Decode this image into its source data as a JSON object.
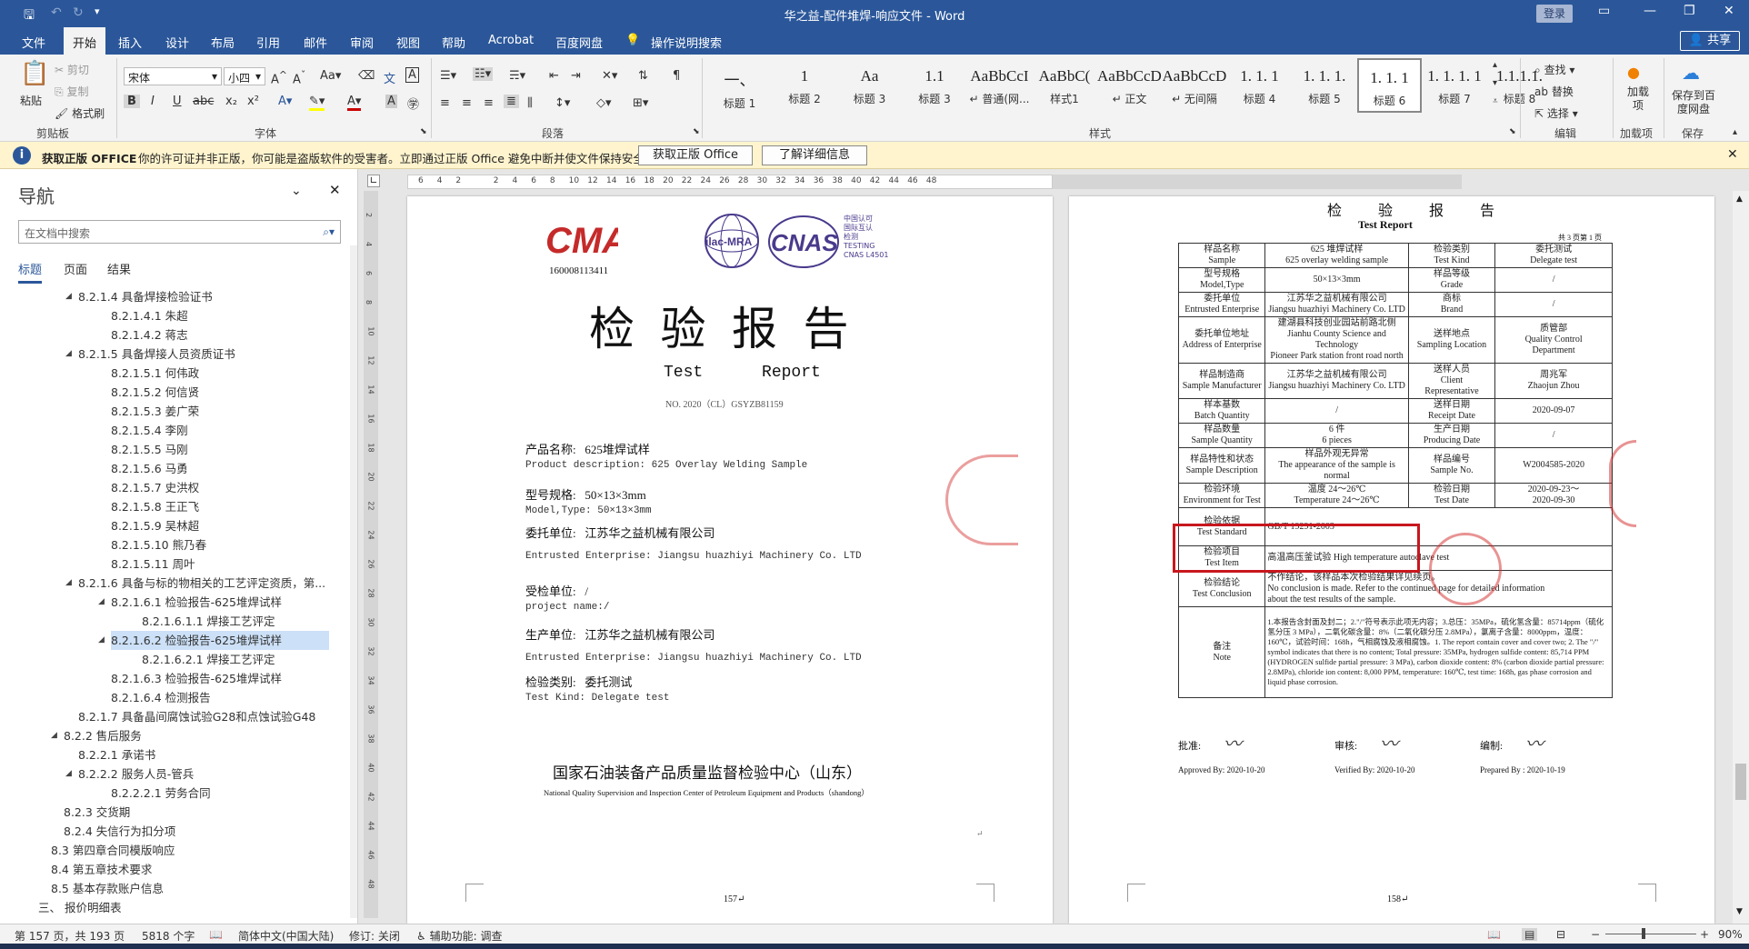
{
  "window": {
    "title": "华之益-配件堆焊-响应文件 - Word",
    "login": "登录"
  },
  "menu": {
    "tabs": [
      "文件",
      "开始",
      "插入",
      "设计",
      "布局",
      "引用",
      "邮件",
      "审阅",
      "视图",
      "帮助",
      "Acrobat",
      "百度网盘"
    ],
    "tellme": "操作说明搜索",
    "share": "共享"
  },
  "ribbon": {
    "clipboard": {
      "paste": "粘贴",
      "cut": "剪切",
      "copy": "复制",
      "painter": "格式刷",
      "label": "剪贴板"
    },
    "font": {
      "name": "宋体",
      "size": "小四",
      "label": "字体"
    },
    "paragraph": {
      "label": "段落"
    },
    "styles": {
      "label": "样式",
      "items": [
        {
          "preview": "一、",
          "name": "标题 1"
        },
        {
          "preview": "1",
          "name": "标题 2"
        },
        {
          "preview": "Aa",
          "name": "标题 3"
        },
        {
          "preview": "1.1",
          "name": "标题 3"
        },
        {
          "preview": "AaBbCcI",
          "name": "↵ 普通(网..."
        },
        {
          "preview": "AaBbC(",
          "name": "样式1"
        },
        {
          "preview": "AaBbCcDdI",
          "name": "↵ 正文"
        },
        {
          "preview": "AaBbCcDdI",
          "name": "↵ 无间隔"
        },
        {
          "preview": "1. 1. 1",
          "name": "标题 4"
        },
        {
          "preview": "1. 1. 1.",
          "name": "标题 5"
        },
        {
          "preview": "1. 1. 1",
          "name": "标题 6"
        },
        {
          "preview": "1. 1. 1. 1",
          "name": "标题 7"
        },
        {
          "preview": "1.1.1.1.",
          "name": "标题 8"
        }
      ]
    },
    "editing": {
      "find": "查找",
      "replace": "替换",
      "select": "选择",
      "label": "编辑"
    },
    "addins": {
      "btn": "加载项",
      "label": "加载项"
    },
    "save": {
      "btn": "保存到百度网盘",
      "label": "保存"
    }
  },
  "warning": {
    "title": "获取正版 OFFICE",
    "text": "你的许可证并非正版，你可能是盗版软件的受害者。立即通过正版 Office 避免中断并使文件保持安全。",
    "btn1": "获取正版 Office",
    "btn2": "了解详细信息"
  },
  "nav": {
    "title": "导航",
    "search_placeholder": "在文档中搜索",
    "tabs": [
      "标题",
      "页面",
      "结果"
    ],
    "items": [
      {
        "text": "8.2.1.4 具备焊接检验证书",
        "lvl": 3,
        "tri": "open"
      },
      {
        "text": "8.2.1.4.1 朱超",
        "lvl": 4,
        "tri": ""
      },
      {
        "text": "8.2.1.4.2 蒋志",
        "lvl": 4,
        "tri": ""
      },
      {
        "text": "8.2.1.5 具备焊接人员资质证书",
        "lvl": 3,
        "tri": "open"
      },
      {
        "text": "8.2.1.5.1 何伟政",
        "lvl": 4,
        "tri": ""
      },
      {
        "text": "8.2.1.5.2 何信贤",
        "lvl": 4,
        "tri": ""
      },
      {
        "text": "8.2.1.5.3 姜广荣",
        "lvl": 4,
        "tri": ""
      },
      {
        "text": "8.2.1.5.4 李刚",
        "lvl": 4,
        "tri": ""
      },
      {
        "text": "8.2.1.5.5 马刚",
        "lvl": 4,
        "tri": ""
      },
      {
        "text": "8.2.1.5.6 马勇",
        "lvl": 4,
        "tri": ""
      },
      {
        "text": "8.2.1.5.7 史洪权",
        "lvl": 4,
        "tri": ""
      },
      {
        "text": "8.2.1.5.8 王正飞",
        "lvl": 4,
        "tri": ""
      },
      {
        "text": "8.2.1.5.9 吴林超",
        "lvl": 4,
        "tri": ""
      },
      {
        "text": "8.2.1.5.10 熊乃春",
        "lvl": 4,
        "tri": ""
      },
      {
        "text": "8.2.1.5.11 周叶",
        "lvl": 4,
        "tri": ""
      },
      {
        "text": "8.2.1.6 具备与标的物相关的工艺评定资质，第...",
        "lvl": 3,
        "tri": "open"
      },
      {
        "text": "8.2.1.6.1 检验报告-625堆焊试样",
        "lvl": 4,
        "tri": "open"
      },
      {
        "text": "8.2.1.6.1.1 焊接工艺评定",
        "lvl": 5,
        "tri": ""
      },
      {
        "text": "8.2.1.6.2 检验报告-625堆焊试样",
        "lvl": 4,
        "tri": "open",
        "sel": true
      },
      {
        "text": "8.2.1.6.2.1 焊接工艺评定",
        "lvl": 5,
        "tri": ""
      },
      {
        "text": "8.2.1.6.3 检验报告-625堆焊试样",
        "lvl": 4,
        "tri": ""
      },
      {
        "text": "8.2.1.6.4 检测报告",
        "lvl": 4,
        "tri": ""
      },
      {
        "text": "8.2.1.7 具备晶间腐蚀试验G28和点蚀试验G48",
        "lvl": 3,
        "tri": ""
      },
      {
        "text": "8.2.2 售后服务",
        "lvl": 2,
        "tri": "open"
      },
      {
        "text": "8.2.2.1 承诺书",
        "lvl": 3,
        "tri": ""
      },
      {
        "text": "8.2.2.2 服务人员-管兵",
        "lvl": 3,
        "tri": "open"
      },
      {
        "text": "8.2.2.2.1 劳务合同",
        "lvl": 4,
        "tri": ""
      },
      {
        "text": "8.2.3 交货期",
        "lvl": 2,
        "tri": ""
      },
      {
        "text": "8.2.4 失信行为扣分项",
        "lvl": 2,
        "tri": ""
      },
      {
        "text": "8.3 第四章合同模版响应",
        "lvl": 1,
        "tri": ""
      },
      {
        "text": "8.4 第五章技术要求",
        "lvl": 1,
        "tri": ""
      },
      {
        "text": "8.5 基本存款账户信息",
        "lvl": 1,
        "tri": ""
      },
      {
        "text": "三、 报价明细表",
        "lvl": 0,
        "tri": ""
      }
    ]
  },
  "ruler": {
    "marks": [
      "6",
      "4",
      "2",
      "",
      "2",
      "4",
      "6",
      "8",
      "10",
      "12",
      "14",
      "16",
      "18",
      "20",
      "22",
      "24",
      "26",
      "28",
      "30",
      "32",
      "34",
      "36",
      "38",
      "40",
      "42",
      "44",
      "46",
      "48"
    ],
    "vmarks": [
      "2",
      "4",
      "6",
      "8",
      "10",
      "12",
      "14",
      "16",
      "18",
      "20",
      "22",
      "24",
      "26",
      "28",
      "30",
      "32",
      "34",
      "36",
      "38",
      "40",
      "42",
      "44",
      "46",
      "48"
    ]
  },
  "page1": {
    "cma_no": "160008113411",
    "cnas_text": [
      "中国认可",
      "国际互认",
      "检测",
      "TESTING",
      "CNAS L4501"
    ],
    "title": "检 验 报 告",
    "subtitle": "Test      Report",
    "no": "NO. 2020（CL）GSYZB81159",
    "fields": [
      {
        "cn": "产品名称:   625堆焊试样",
        "en": "Product description: 625 Overlay Welding Sample"
      },
      {
        "cn": "型号规格:   50×13×3mm",
        "en": "Model,Type: 50×13×3mm"
      },
      {
        "cn": "委托单位:   江苏华之益机械有限公司",
        "en": "Entrusted Enterprise: Jiangsu huazhiyi Machinery Co. LTD"
      },
      {
        "cn": "受检单位:   /",
        "en": "project name:/"
      },
      {
        "cn": "生产单位:   江苏华之益机械有限公司",
        "en": "Entrusted Enterprise: Jiangsu huazhiyi Machinery Co. LTD"
      },
      {
        "cn": "检验类别:   委托测试",
        "en": "Test Kind: Delegate test"
      }
    ],
    "org_cn": "国家石油装备产品质量监督检验中心（山东）",
    "org_en": "National Quality Supervision and Inspection Center of Petroleum Equipment and Products（shandong）",
    "page_num": "157↵"
  },
  "page2": {
    "title": "检 验 报 告",
    "subtitle": "Test  Report",
    "pages": "共 3 页第 1 页",
    "rows": [
      [
        "样品名称\nSample",
        "625 堆焊试样\n625 overlay welding sample",
        "检验类别\nTest Kind",
        "委托测试\nDelegate test"
      ],
      [
        "型号规格\nModel,Type",
        "50×13×3mm",
        "样品等级\nGrade",
        "/"
      ],
      [
        "委托单位\nEntrusted Enterprise",
        "江苏华之益机械有限公司\nJiangsu huazhiyi Machinery Co. LTD",
        "商标\nBrand",
        "/"
      ],
      [
        "委托单位地址\nAddress of Enterprise",
        "建湖县科技创业园站前路北侧\nJianhu County Science and Technology\nPioneer Park station front road north",
        "送样地点\nSampling Location",
        "质管部\nQuality Control\nDepartment"
      ],
      [
        "样品制造商\nSample Manufacturer",
        "江苏华之益机械有限公司\nJiangsu huazhiyi Machinery Co. LTD",
        "送样人员\nClient\nRepresentative",
        "周兆军\nZhaojun Zhou"
      ],
      [
        "样本基数\nBatch Quantity",
        "/",
        "送样日期\nReceipt Date",
        "2020-09-07"
      ],
      [
        "样品数量\nSample Quantity",
        "6 件\n6 pieces",
        "生产日期\nProducing Date",
        "/"
      ],
      [
        "样品特性和状态\nSample Description",
        "样品外观无异常\nThe appearance of the sample is\nnormal",
        "样品编号\nSample No.",
        "W2004585-2020"
      ],
      [
        "检验环境\nEnvironment for Test",
        "温度 24～26℃\nTemperature 24～26℃",
        "检验日期\nTest Date",
        "2020-09-23～\n2020-09-30"
      ]
    ],
    "std_label": "检验依据\nTest Standard",
    "std_value": "GB/T 19291-2003",
    "item_label": "检验项目\nTest Item",
    "item_value": "高温高压釜试验  High temperature autoclave test",
    "concl_label": "检验结论\nTest Conclusion",
    "concl_value": "不作结论，该样品本次检验结果详见续页。\nNo conclusion is made. Refer to the continued page for detailed information\nabout the test results of the sample.",
    "note_label": "备注\nNote",
    "note_value": "1.本报告含封面及封二；2.\"/\"符号表示此项无内容；3.总压：35MPa，硫化氢含量：85714ppm（硫化氢分压 3 MPa），二氧化碳含量：8%（二氧化碳分压 2.8MPa），氯离子含量：8000ppm，温度：160℃，试验时间：168h，气相腐蚀及液相腐蚀。1. The report contain cover and cover two; 2. The \"/\" symbol indicates that there is no content; Total pressure: 35MPa, hydrogen sulfide content: 85,714 PPM (HYDROGEN sulfide partial pressure: 3 MPa), carbon dioxide content: 8% (carbon dioxide partial pressure: 2.8MPa), chloride ion content: 8,000 PPM, temperature: 160℃, test time: 168h, gas phase corrosion and liquid phase corrosion.",
    "sign": [
      {
        "cn": "批准:",
        "en": "Approved By: 2020-10-20"
      },
      {
        "cn": "审核:",
        "en": "Verified By: 2020-10-20"
      },
      {
        "cn": "编制:",
        "en": "Prepared By : 2020-10-19"
      }
    ],
    "page_num": "158↵"
  },
  "status": {
    "page": "第 157 页，共 193 页",
    "words": "5818 个字",
    "lang": "简体中文(中国大陆)",
    "track": "修订: 关闭",
    "access": "辅助功能: 调查",
    "zoom": "90%"
  }
}
